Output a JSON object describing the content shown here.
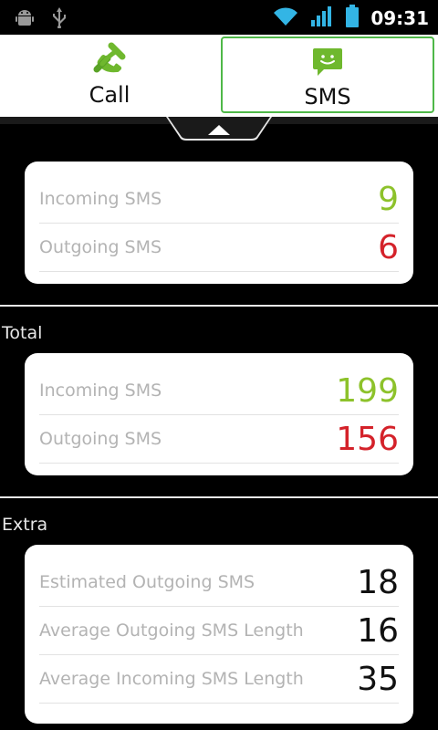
{
  "status_bar": {
    "time": "09:31",
    "left_icons": [
      "android-debug-icon",
      "usb-icon"
    ],
    "right_icons": [
      "wifi-icon",
      "signal-icon",
      "battery-icon"
    ]
  },
  "tabs": [
    {
      "label": "Call",
      "icon": "phone-icon",
      "selected": false
    },
    {
      "label": "SMS",
      "icon": "sms-icon",
      "selected": true
    }
  ],
  "cards": {
    "current": {
      "rows": [
        {
          "label": "Incoming SMS",
          "value": "9"
        },
        {
          "label": "Outgoing SMS",
          "value": "6"
        }
      ]
    },
    "total": {
      "title": "Total",
      "rows": [
        {
          "label": "Incoming SMS",
          "value": "199"
        },
        {
          "label": "Outgoing SMS",
          "value": "156"
        }
      ]
    },
    "extra": {
      "title": "Extra",
      "rows": [
        {
          "label": "Estimated Outgoing SMS",
          "value": "18"
        },
        {
          "label": "Average Outgoing SMS Length",
          "value": "16"
        },
        {
          "label": "Average Incoming SMS Length",
          "value": "35"
        }
      ]
    }
  },
  "colors": {
    "incoming": "#8dc22b",
    "outgoing": "#d4222a",
    "accent": "#4fb848",
    "status_icons": "#33b5e5"
  }
}
